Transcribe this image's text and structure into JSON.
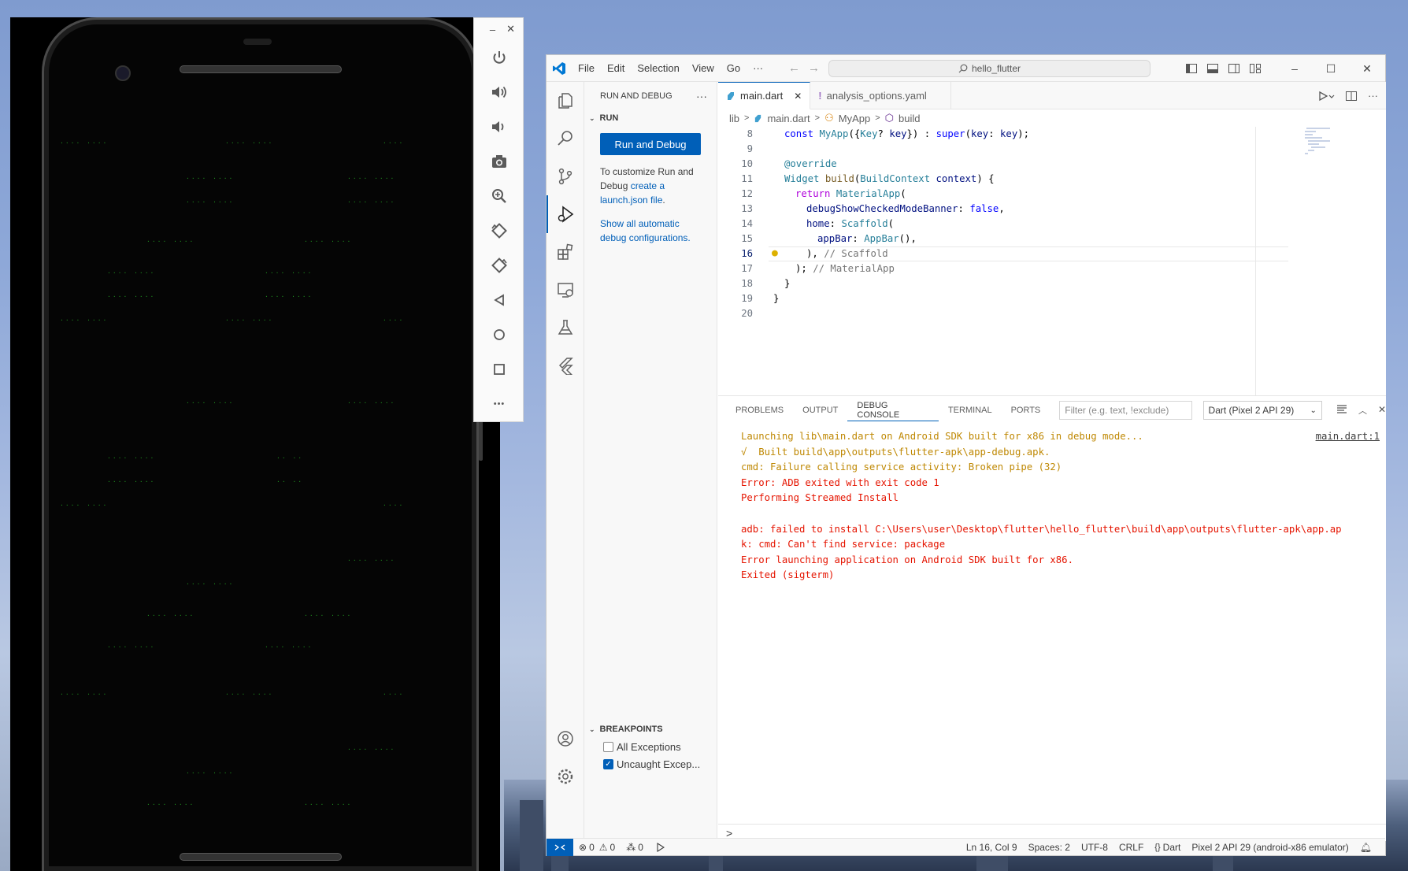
{
  "emulator": {
    "toolbar_window_buttons": [
      "–",
      "✕"
    ],
    "toolbar_icons": [
      "power-icon",
      "volume-up-icon",
      "volume-down-icon",
      "camera-icon",
      "zoom-icon",
      "rotate-left-icon",
      "rotate-right-icon",
      "back-icon",
      "home-icon",
      "overview-icon",
      "more-icon"
    ],
    "more_label": "•••"
  },
  "titlebar": {
    "menu": [
      "File",
      "Edit",
      "Selection",
      "View",
      "Go",
      "···"
    ],
    "search": "hello_flutter",
    "window_controls": [
      "–",
      "☐",
      "✕"
    ]
  },
  "sidebar": {
    "title": "RUN AND DEBUG",
    "more": "···",
    "run_section": "RUN",
    "run_button": "Run and Debug",
    "customize_text_1": "To customize Run and Debug ",
    "customize_link": "create a launch.json file",
    "customize_text_2": ".",
    "show_all_link": "Show all automatic debug configurations",
    "show_all_end": ".",
    "breakpoints_title": "BREAKPOINTS",
    "breakpoints": [
      {
        "label": "All Exceptions",
        "checked": false
      },
      {
        "label": "Uncaught Excep...",
        "checked": true
      }
    ]
  },
  "editor": {
    "tabs": [
      {
        "label": "main.dart",
        "active": true,
        "close": "✕"
      },
      {
        "label": "analysis_options.yaml",
        "active": false,
        "marker": "!"
      }
    ],
    "breadcrumbs": [
      "lib",
      ">",
      "main.dart",
      ">",
      "MyApp",
      ">",
      "build"
    ],
    "line_numbers": [
      "8",
      "9",
      "10",
      "11",
      "12",
      "13",
      "14",
      "15",
      "16",
      "17",
      "18",
      "19",
      "20"
    ],
    "current_line": "16"
  },
  "panel": {
    "tabs": [
      "PROBLEMS",
      "OUTPUT",
      "DEBUG CONSOLE",
      "TERMINAL",
      "PORTS"
    ],
    "active_tab": "DEBUG CONSOLE",
    "filter_placeholder": "Filter (e.g. text, !exclude)",
    "launch_config": "Dart (Pixel 2 API 29)",
    "source_link": "main.dart:1",
    "console_lines": [
      {
        "text": "Launching lib\\main.dart on Android SDK built for x86 in debug mode...",
        "kind": "warn"
      },
      {
        "text": "√  Built build\\app\\outputs\\flutter-apk\\app-debug.apk.",
        "kind": "warn"
      },
      {
        "text": "cmd: Failure calling service activity: Broken pipe (32)",
        "kind": "warn"
      },
      {
        "text": "Error: ADB exited with exit code 1",
        "kind": "err"
      },
      {
        "text": "Performing Streamed Install",
        "kind": "err"
      },
      {
        "text": "",
        "kind": "err"
      },
      {
        "text": "adb: failed to install C:\\Users\\user\\Desktop\\flutter\\hello_flutter\\build\\app\\outputs\\flutter-apk\\app.ap",
        "kind": "err"
      },
      {
        "text": "k: cmd: Can't find service: package",
        "kind": "err"
      },
      {
        "text": "Error launching application on Android SDK built for x86.",
        "kind": "err"
      },
      {
        "text": "Exited (sigterm)",
        "kind": "err"
      }
    ],
    "repl_prompt": ">"
  },
  "statusbar": {
    "errors": "0",
    "warnings": "0",
    "ports": "0",
    "position": "Ln 16, Col 9",
    "spaces": "Spaces: 2",
    "encoding": "UTF-8",
    "eol": "CRLF",
    "language_braces": "{}",
    "language": "Dart",
    "device": "Pixel 2 API 29 (android-x86 emulator)"
  },
  "colors": {
    "accent": "#005fb8",
    "console_warn": "#bf8803",
    "console_error": "#e51400"
  }
}
